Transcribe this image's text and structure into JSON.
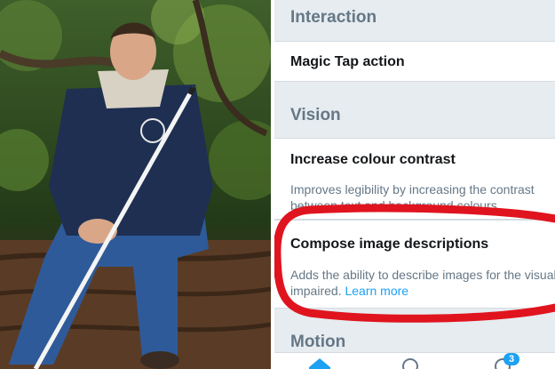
{
  "settings": {
    "interaction_header": "Interaction",
    "magic_tap_label": "Magic Tap action",
    "vision_header": "Vision",
    "contrast_title": "Increase colour contrast",
    "contrast_desc": "Improves legibility by increasing the contrast between text and background colours.",
    "compose_title": "Compose image descriptions",
    "compose_desc": "Adds the ability to describe images for the visually impaired.",
    "learn_more": "Learn more",
    "motion_header": "Motion"
  },
  "tabbar": {
    "icons": [
      "home-icon",
      "search-icon",
      "notifications-icon"
    ],
    "notification_count": "3"
  },
  "colors": {
    "highlight_circle": "#e0141e",
    "link": "#1da1f2",
    "section_bg": "#e6ecf0"
  }
}
